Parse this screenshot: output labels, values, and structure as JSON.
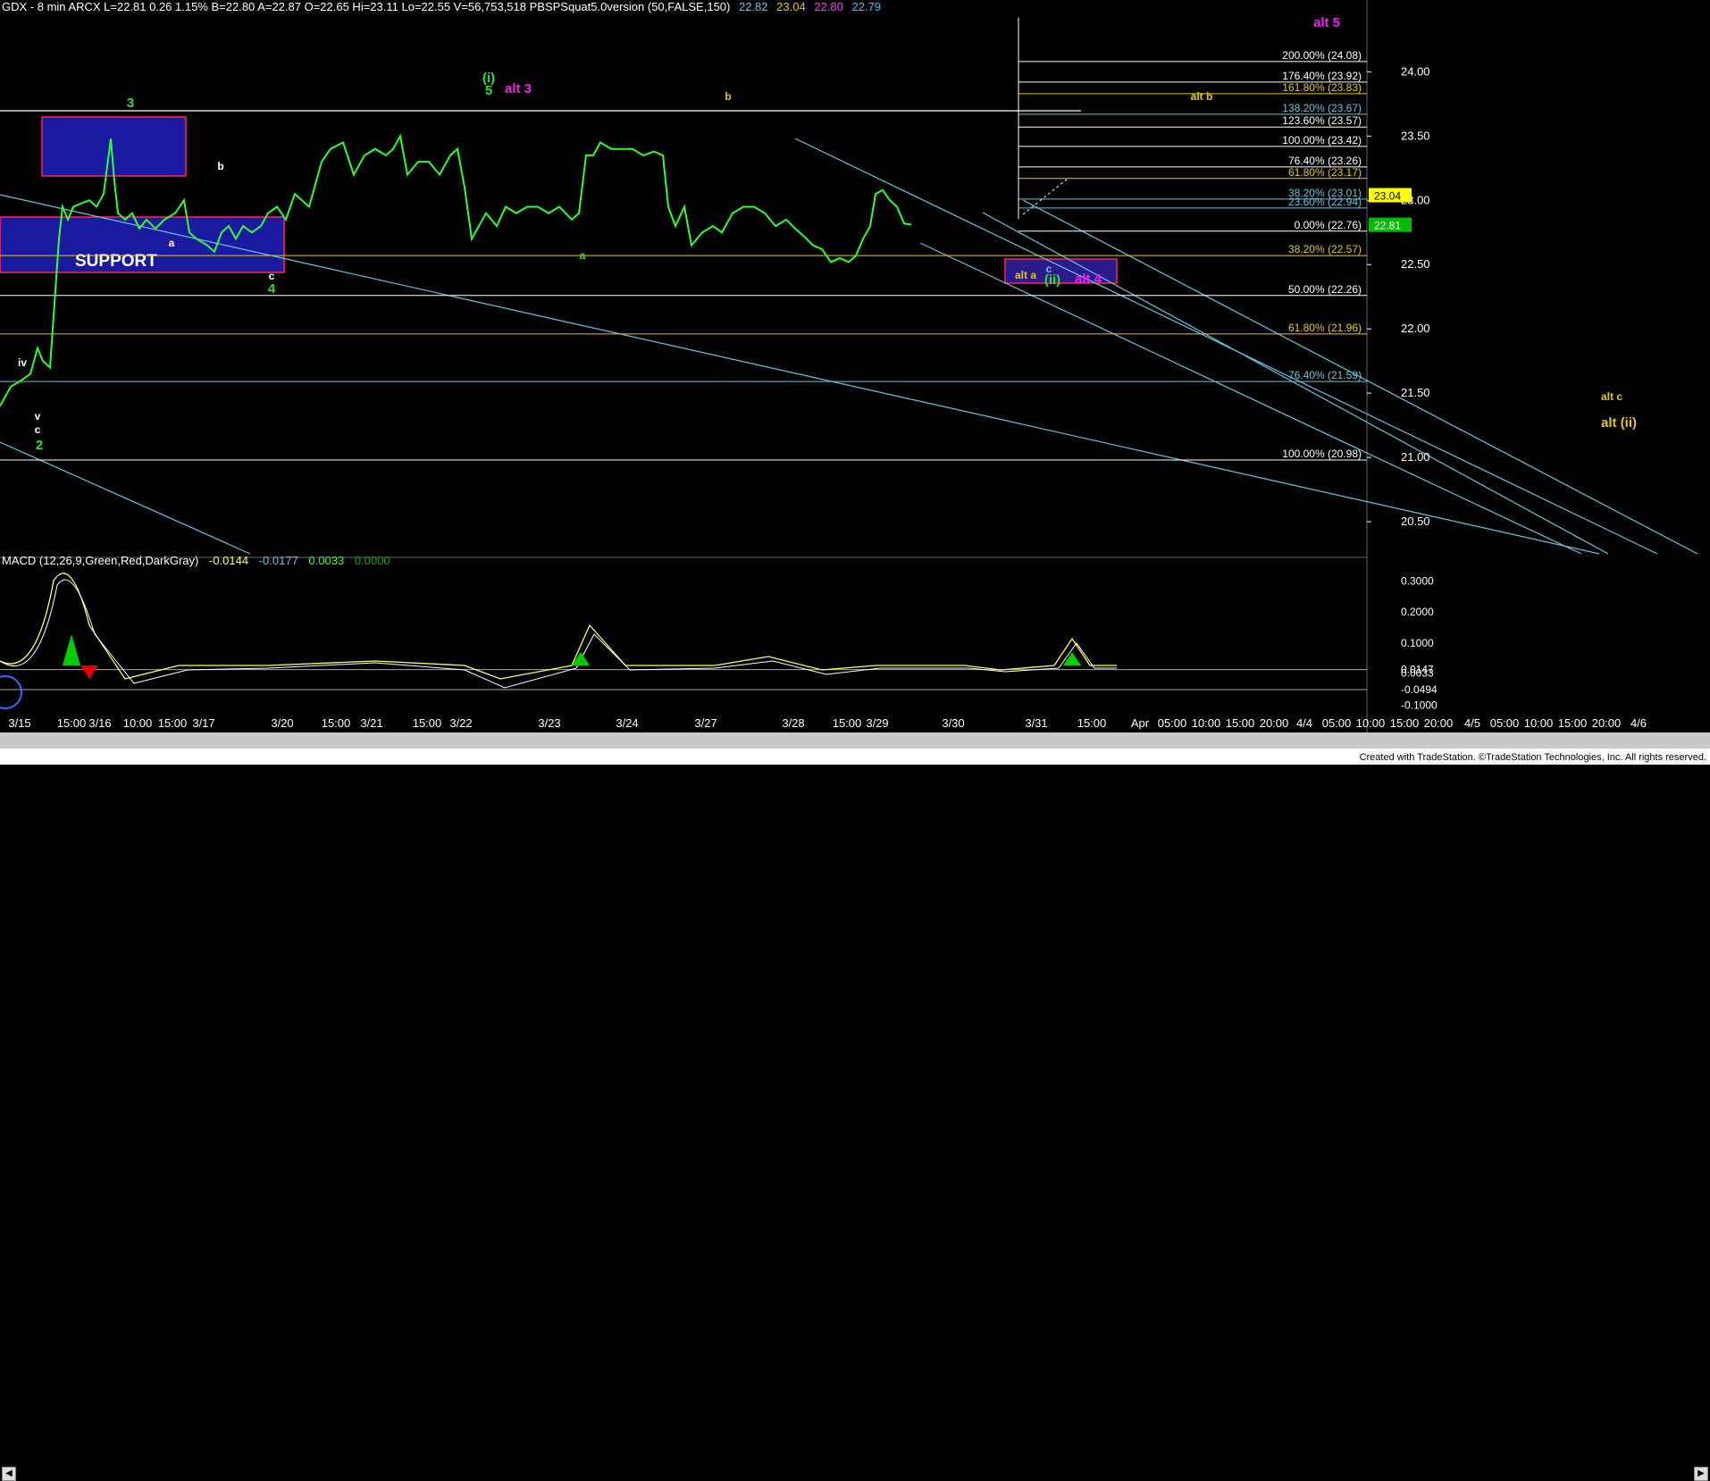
{
  "header": {
    "symbol_info": "GDX - 8 min  ARCX  L=22.81  0.26  1.15%  B=22.80  A=22.87  O=22.65  Hi=23.11  Lo=22.55  V=56,753,518  PBSPSquat5.0version (50,FALSE,150)",
    "ind_values": [
      "22.82",
      "23.04",
      "22.80",
      "22.79"
    ],
    "ind_colors": [
      "#6ac4e0",
      "#e6c619",
      "#ee44ee",
      "#44bbff"
    ]
  },
  "macd": {
    "label": "MACD (12,26,9,Green,Red,DarkGray)",
    "values": [
      "-0.0144",
      "-0.0177",
      "0.0033",
      "0.0000"
    ],
    "colors": [
      "#ffff66",
      "#6ac4e0",
      "#33ff33",
      "#00aa00"
    ],
    "y_ticks": [
      "0.3000",
      "0.2000",
      "0.1000",
      "0.0147",
      "0.0033",
      "-0.0494",
      "-0.1000"
    ]
  },
  "footer": "Created with TradeStation. ©TradeStation Technologies, Inc. All rights reserved.",
  "chart_data": {
    "type": "line",
    "symbol": "GDX",
    "interval": "8 min",
    "ylim": [
      20.25,
      24.35
    ],
    "y_ticks": [
      20.5,
      21.0,
      21.5,
      22.0,
      22.5,
      23.0,
      23.5,
      24.0
    ],
    "y_tick_labels": [
      "20.50",
      "21.00",
      "21.50",
      "22.00",
      "22.50",
      "23.00",
      "23.50",
      "24.00"
    ],
    "last_price": "22.81",
    "last_marker": "23.04",
    "x_labels": [
      "3/15",
      "15:00",
      "3/16",
      "10:00",
      "15:00",
      "3/17",
      "3/20",
      "15:00",
      "3/21",
      "15:00",
      "3/22",
      "3/23",
      "3/24",
      "3/27",
      "3/28",
      "15:00",
      "3/29",
      "3/30",
      "3/31",
      "15:00",
      "Apr",
      "05:00",
      "10:00",
      "15:00",
      "20:00",
      "4/4",
      "05:00",
      "10:00",
      "15:00",
      "20:00",
      "4/5",
      "05:00",
      "10:00",
      "15:00",
      "20:00",
      "4/6"
    ],
    "price_path": [
      [
        0,
        21.4
      ],
      [
        12,
        21.55
      ],
      [
        24,
        21.6
      ],
      [
        34,
        21.65
      ],
      [
        42,
        21.85
      ],
      [
        48,
        21.75
      ],
      [
        56,
        21.7
      ],
      [
        62,
        22.3
      ],
      [
        66,
        22.7
      ],
      [
        70,
        22.95
      ],
      [
        76,
        22.85
      ],
      [
        82,
        22.95
      ],
      [
        92,
        22.98
      ],
      [
        100,
        23.0
      ],
      [
        108,
        22.95
      ],
      [
        116,
        23.05
      ],
      [
        124,
        23.48
      ],
      [
        128,
        23.15
      ],
      [
        132,
        22.9
      ],
      [
        140,
        22.85
      ],
      [
        148,
        22.9
      ],
      [
        156,
        22.78
      ],
      [
        164,
        22.85
      ],
      [
        174,
        22.78
      ],
      [
        184,
        22.85
      ],
      [
        196,
        22.9
      ],
      [
        206,
        23.0
      ],
      [
        212,
        22.75
      ],
      [
        220,
        22.7
      ],
      [
        232,
        22.65
      ],
      [
        240,
        22.6
      ],
      [
        248,
        22.75
      ],
      [
        256,
        22.8
      ],
      [
        264,
        22.7
      ],
      [
        272,
        22.8
      ],
      [
        282,
        22.75
      ],
      [
        292,
        22.8
      ],
      [
        300,
        22.9
      ],
      [
        310,
        22.95
      ],
      [
        320,
        22.85
      ],
      [
        330,
        23.05
      ],
      [
        346,
        22.95
      ],
      [
        360,
        23.3
      ],
      [
        370,
        23.4
      ],
      [
        384,
        23.45
      ],
      [
        396,
        23.2
      ],
      [
        408,
        23.35
      ],
      [
        420,
        23.4
      ],
      [
        432,
        23.35
      ],
      [
        440,
        23.4
      ],
      [
        448,
        23.5
      ],
      [
        456,
        23.2
      ],
      [
        468,
        23.3
      ],
      [
        480,
        23.3
      ],
      [
        492,
        23.2
      ],
      [
        504,
        23.35
      ],
      [
        512,
        23.4
      ],
      [
        520,
        23.1
      ],
      [
        528,
        22.7
      ],
      [
        536,
        22.8
      ],
      [
        544,
        22.9
      ],
      [
        556,
        22.8
      ],
      [
        566,
        22.95
      ],
      [
        578,
        22.9
      ],
      [
        590,
        22.95
      ],
      [
        602,
        22.95
      ],
      [
        614,
        22.9
      ],
      [
        626,
        22.95
      ],
      [
        640,
        22.85
      ],
      [
        648,
        22.9
      ],
      [
        656,
        23.35
      ],
      [
        664,
        23.35
      ],
      [
        672,
        23.45
      ],
      [
        684,
        23.4
      ],
      [
        696,
        23.4
      ],
      [
        708,
        23.4
      ],
      [
        720,
        23.35
      ],
      [
        732,
        23.38
      ],
      [
        742,
        23.35
      ],
      [
        748,
        22.95
      ],
      [
        756,
        22.8
      ],
      [
        766,
        22.95
      ],
      [
        774,
        22.65
      ],
      [
        786,
        22.75
      ],
      [
        798,
        22.8
      ],
      [
        808,
        22.75
      ],
      [
        820,
        22.9
      ],
      [
        832,
        22.95
      ],
      [
        844,
        22.95
      ],
      [
        856,
        22.9
      ],
      [
        868,
        22.8
      ],
      [
        880,
        22.85
      ],
      [
        890,
        22.78
      ],
      [
        900,
        22.72
      ],
      [
        910,
        22.65
      ],
      [
        920,
        22.62
      ],
      [
        930,
        22.52
      ],
      [
        940,
        22.55
      ],
      [
        950,
        22.52
      ],
      [
        958,
        22.57
      ],
      [
        966,
        22.7
      ],
      [
        974,
        22.8
      ],
      [
        980,
        23.05
      ],
      [
        988,
        23.08
      ],
      [
        996,
        23.0
      ],
      [
        1004,
        22.95
      ],
      [
        1012,
        22.82
      ],
      [
        1020,
        22.81
      ]
    ],
    "fib_levels": [
      {
        "label": "200.00% (24.08)",
        "value": 24.08,
        "color": "#ffffff"
      },
      {
        "label": "176.40% (23.92)",
        "value": 23.92,
        "color": "#ffffff"
      },
      {
        "label": "161.80% (23.83)",
        "value": 23.83,
        "color": "#e6c619"
      },
      {
        "label": "138.20% (23.67)",
        "value": 23.67,
        "color": "#6ac4e0"
      },
      {
        "label": "123.60% (23.57)",
        "value": 23.57,
        "color": "#ffffff"
      },
      {
        "label": "100.00% (23.42)",
        "value": 23.42,
        "color": "#ffffff"
      },
      {
        "label": "76.40% (23.26)",
        "value": 23.26,
        "color": "#ffffff"
      },
      {
        "label": "61.80% (23.17)",
        "value": 23.17,
        "color": "#e6c619"
      },
      {
        "label": "38.20% (23.01)",
        "value": 23.01,
        "color": "#6ac4e0"
      },
      {
        "label": "23.60% (22.94)",
        "value": 22.94,
        "color": "#6ac4e0"
      },
      {
        "label": "0.00% (22.76)",
        "value": 22.76,
        "color": "#ffffff"
      },
      {
        "label": "38.20% (22.57)",
        "value": 22.57,
        "color": "#e6c619"
      },
      {
        "label": "50.00% (22.26)",
        "value": 22.26,
        "color": "#ffffff"
      },
      {
        "label": "61.80% (21.96)",
        "value": 21.96,
        "color": "#e6c619"
      },
      {
        "label": "76.40% (21.59)",
        "value": 21.59,
        "color": "#6ac4e0"
      },
      {
        "label": "100.00% (20.98)",
        "value": 20.98,
        "color": "#ffffff"
      }
    ],
    "support_label": "SUPPORT",
    "wave_labels": [
      {
        "text": "3",
        "color": "#33dd33"
      },
      {
        "text": "(i)",
        "color": "#33dd33"
      },
      {
        "text": "5",
        "color": "#33dd33"
      },
      {
        "text": "alt 3",
        "color": "#ee22ee"
      },
      {
        "text": "b",
        "color": "#e6c619"
      },
      {
        "text": "alt 5",
        "color": "#ee22ee"
      },
      {
        "text": "alt b",
        "color": "#e6c619"
      },
      {
        "text": "b",
        "color": "#ffffff"
      },
      {
        "text": "a",
        "color": "#ffffff"
      },
      {
        "text": "c",
        "color": "#ffffff"
      },
      {
        "text": "4",
        "color": "#33dd33"
      },
      {
        "text": "a",
        "color": "#33dd33"
      },
      {
        "text": "iv",
        "color": "#ffffff"
      },
      {
        "text": "v",
        "color": "#ffffff"
      },
      {
        "text": "c",
        "color": "#ffffff"
      },
      {
        "text": "2",
        "color": "#33dd33"
      },
      {
        "text": "alt a",
        "color": "#e6c619"
      },
      {
        "text": "c",
        "color": "#6ac4e0"
      },
      {
        "text": "(ii)",
        "color": "#33dd33"
      },
      {
        "text": "alt 4",
        "color": "#ee22ee"
      },
      {
        "text": "alt c",
        "color": "#e6c619"
      },
      {
        "text": "alt (ii)",
        "color": "#e6c619"
      }
    ]
  }
}
